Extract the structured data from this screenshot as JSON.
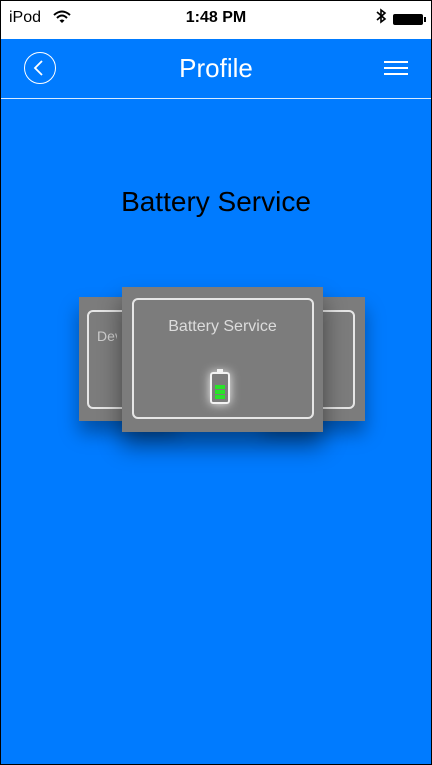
{
  "status_bar": {
    "carrier": "iPod",
    "time": "1:48 PM",
    "bluetooth_icon": "bluetooth-icon",
    "battery_icon": "battery-icon",
    "wifi_icon": "wifi-icon"
  },
  "nav": {
    "title": "Profile",
    "back_icon": "chevron-left-icon",
    "menu_icon": "hamburger-menu-icon"
  },
  "main": {
    "title": "Battery Service",
    "cards": [
      {
        "label": "Dev"
      },
      {
        "label": "Battery Service",
        "icon": "battery-level-icon"
      },
      {
        "label": ""
      }
    ]
  },
  "colors": {
    "background": "#007bff",
    "card": "#7c7c7c",
    "battery_level": "#29e329"
  }
}
